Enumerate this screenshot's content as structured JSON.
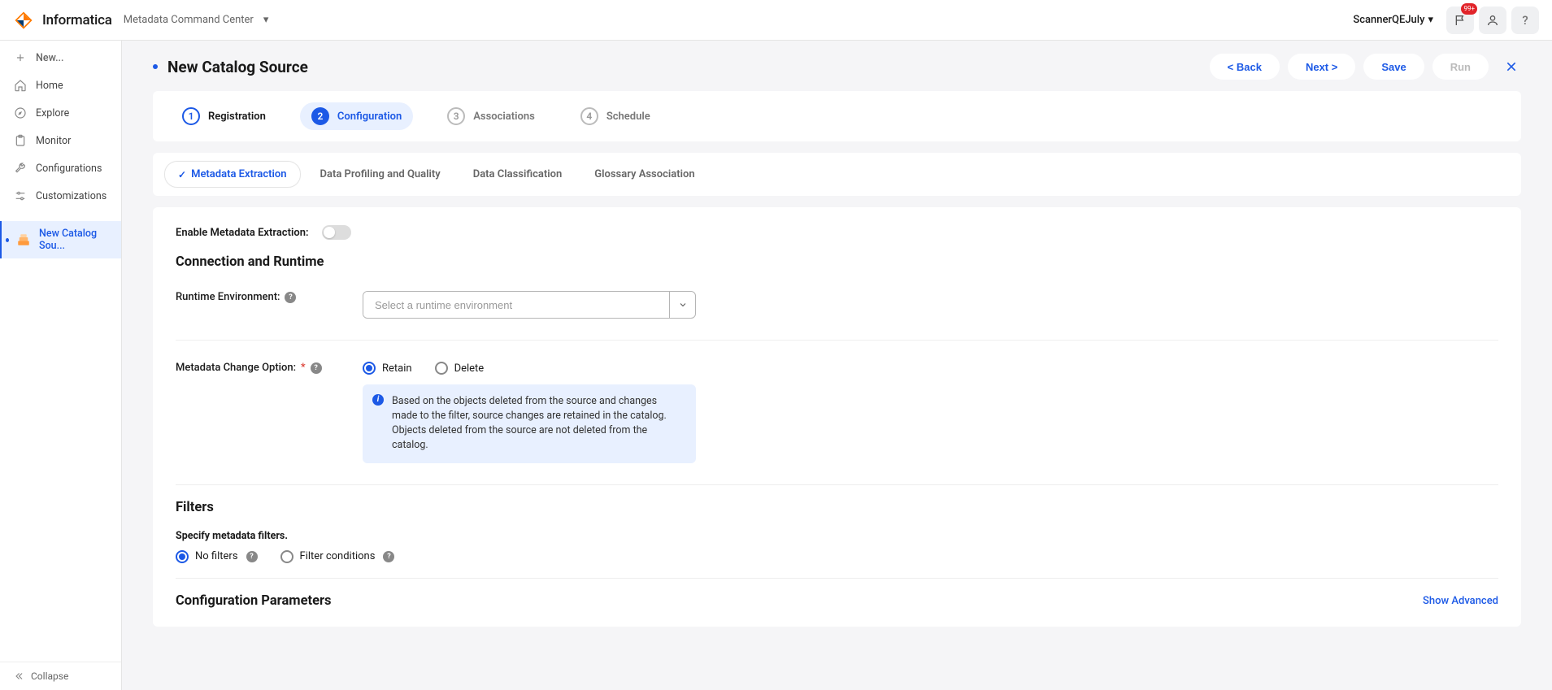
{
  "brand": "Informatica",
  "product": "Metadata Command Center",
  "user": "ScannerQEJuly",
  "notification_badge": "99+",
  "sidebar": {
    "new_label": "New...",
    "home": "Home",
    "explore": "Explore",
    "monitor": "Monitor",
    "configurations": "Configurations",
    "customizations": "Customizations",
    "active": "New Catalog Sou...",
    "collapse": "Collapse"
  },
  "page_title": "New Catalog Source",
  "actions": {
    "back": "< Back",
    "next": "Next >",
    "save": "Save",
    "run": "Run"
  },
  "stepper": {
    "s1": "Registration",
    "s2": "Configuration",
    "s3": "Associations",
    "s4": "Schedule"
  },
  "subtabs": {
    "t1": "Metadata Extraction",
    "t2": "Data Profiling and Quality",
    "t3": "Data Classification",
    "t4": "Glossary Association"
  },
  "form": {
    "enable_label": "Enable Metadata Extraction:",
    "section_conn": "Connection and Runtime",
    "runtime_label": "Runtime Environment:",
    "runtime_placeholder": "Select a runtime environment",
    "change_label": "Metadata Change Option:",
    "retain": "Retain",
    "delete": "Delete",
    "info_text": "Based on the objects deleted from the source and changes made to the filter, source changes are retained in the catalog. Objects deleted from the source are not deleted from the catalog.",
    "section_filters": "Filters",
    "filters_sub": "Specify metadata filters.",
    "no_filters": "No filters",
    "filter_cond": "Filter conditions",
    "section_config": "Configuration Parameters",
    "show_advanced": "Show Advanced"
  }
}
